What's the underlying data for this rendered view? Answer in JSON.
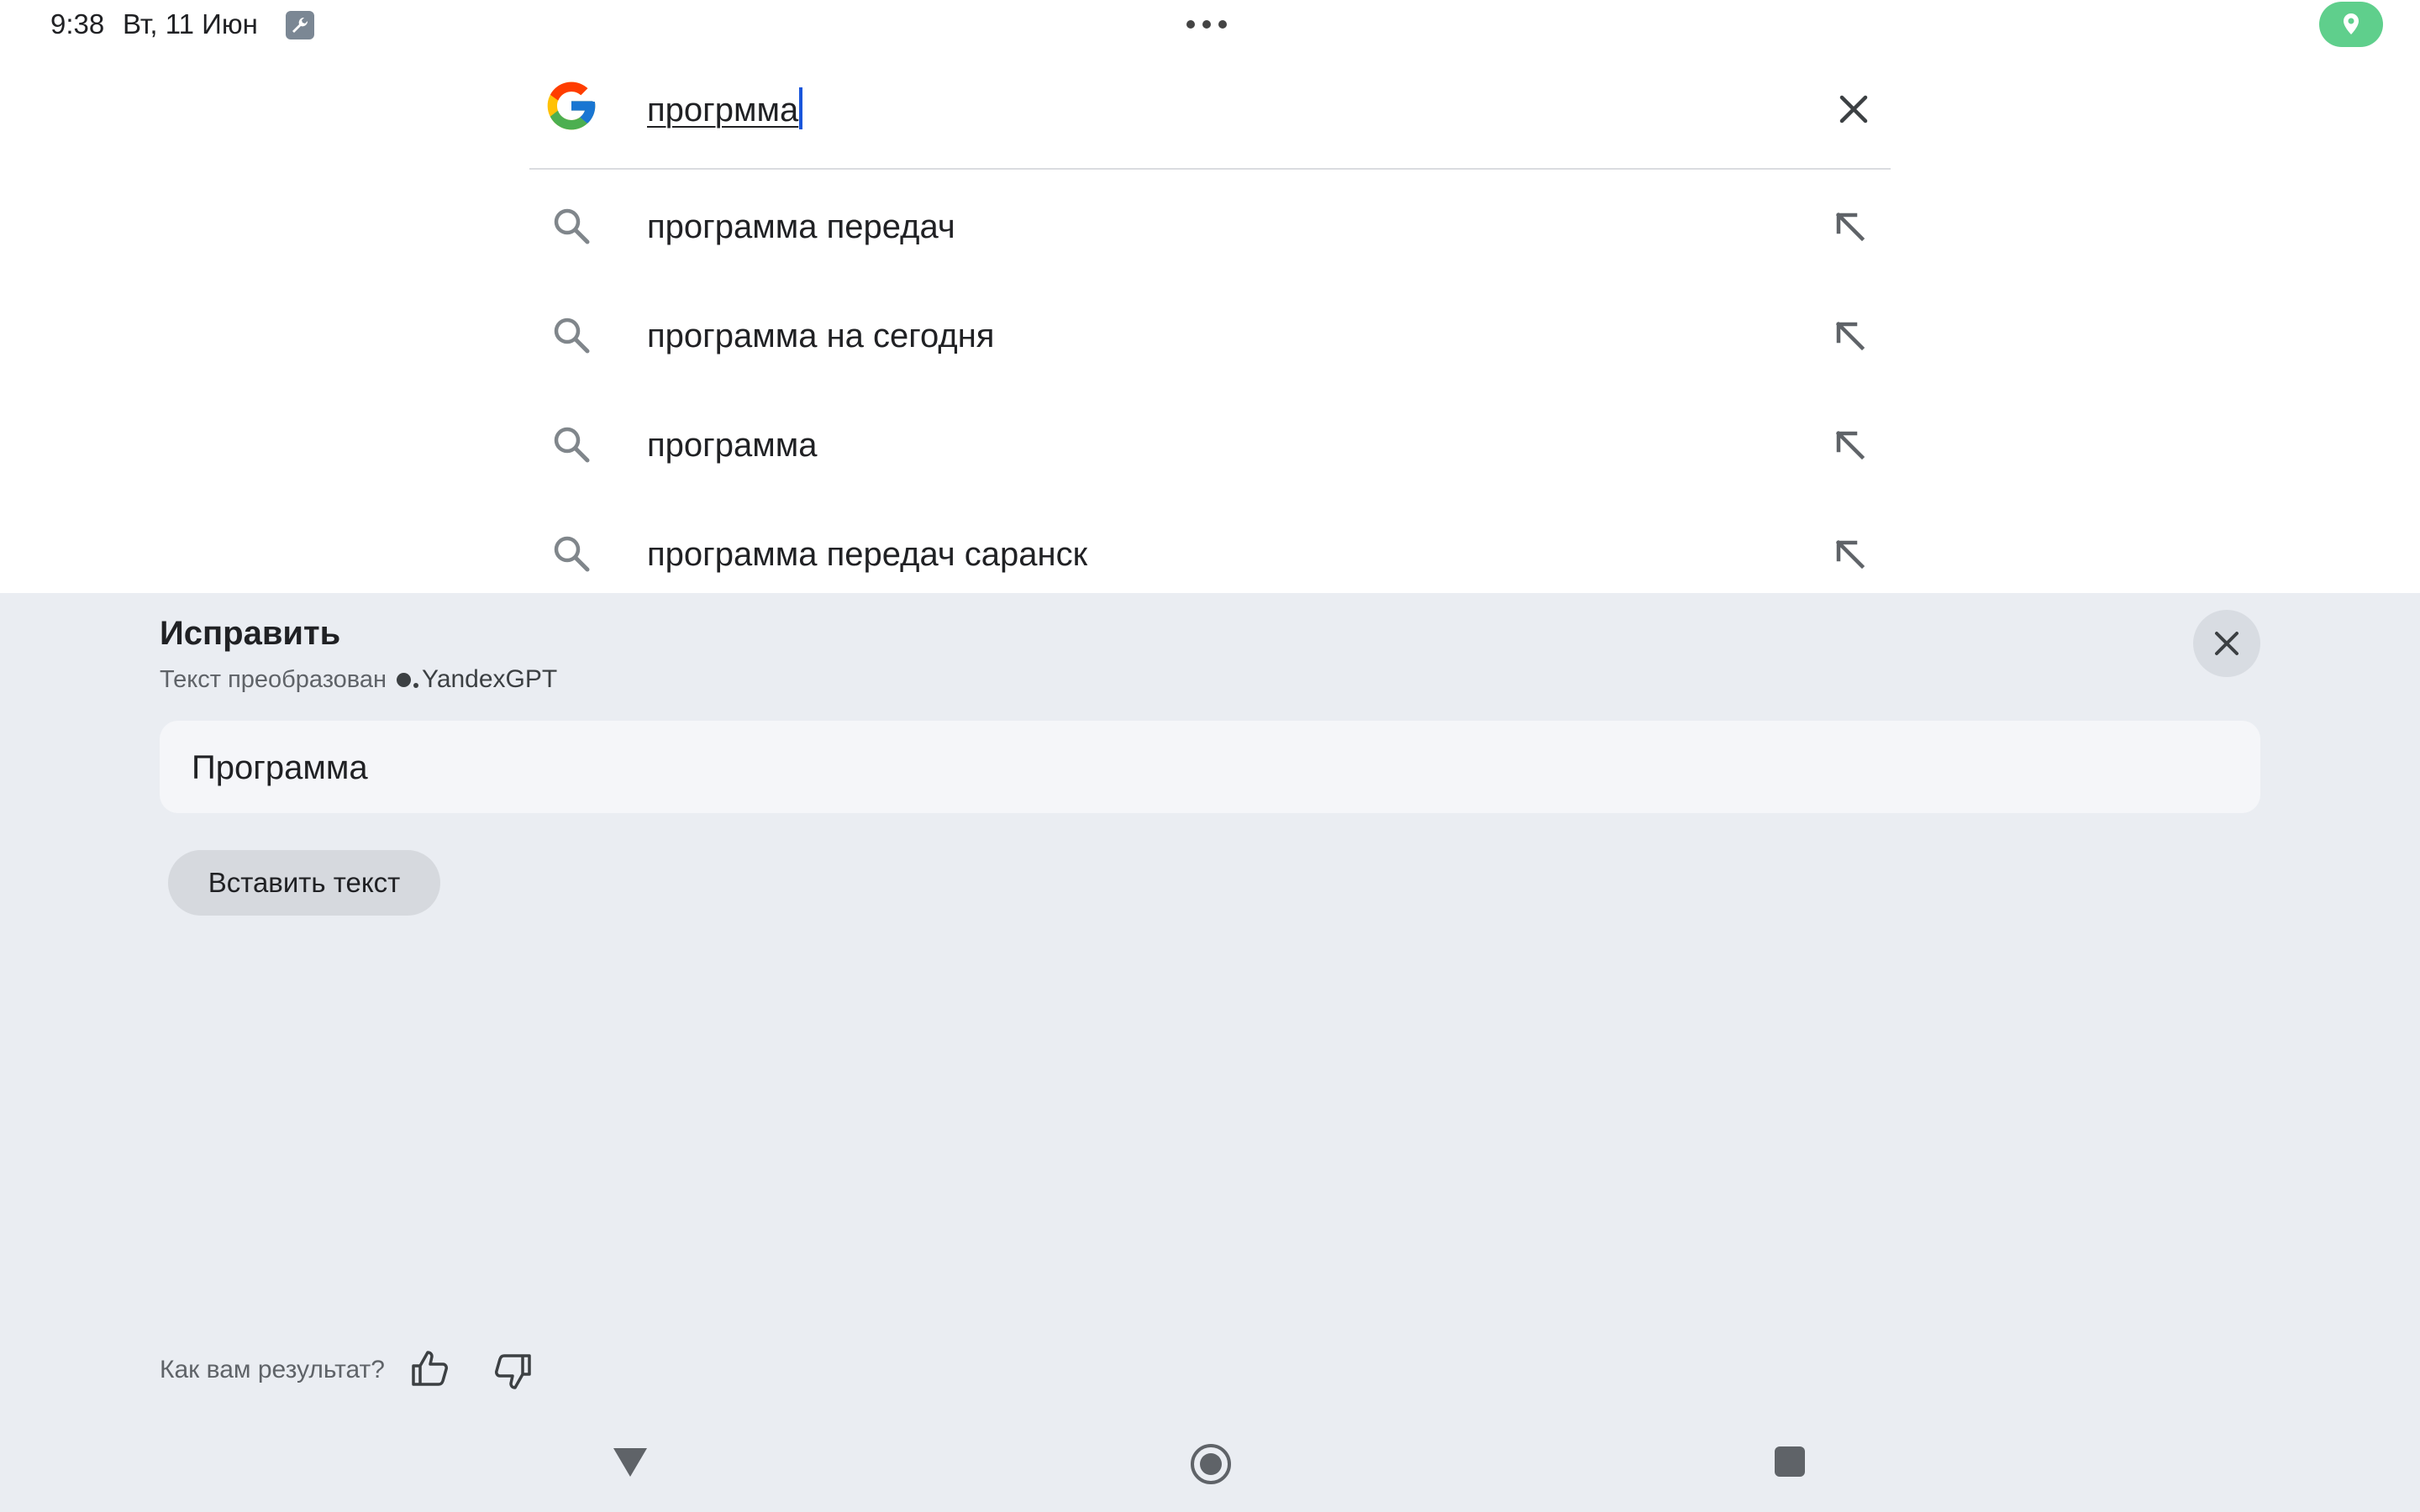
{
  "status_bar": {
    "time": "9:38",
    "date": "Вт, 11 Июн",
    "icons": [
      "wrench-icon",
      "more-dots-icon",
      "location-icon"
    ],
    "location_color": "#5fcf8c"
  },
  "search": {
    "query": "прогрмма",
    "logo": "google-g-logo",
    "clear_icon": "close-icon"
  },
  "suggestions": [
    {
      "text": "программа передач"
    },
    {
      "text": "программа на сегодня"
    },
    {
      "text": "программа"
    },
    {
      "text": "программа передач саранск"
    }
  ],
  "panel": {
    "title": "Исправить",
    "subtitle": "Текст преобразован",
    "brand": "YandexGPT",
    "result": "Программа",
    "insert_label": "Вставить текст",
    "feedback_label": "Как вам результат?",
    "background": "#eaedf2"
  },
  "navbar": {
    "icons": [
      "back-triangle-icon",
      "home-circle-icon",
      "recents-square-icon"
    ]
  }
}
